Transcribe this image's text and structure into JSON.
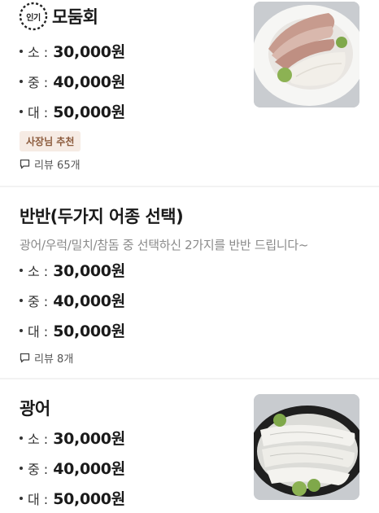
{
  "items": [
    {
      "badge": "인기",
      "name": "모둠회",
      "prices": [
        {
          "size": "소 :",
          "price": "30,000원"
        },
        {
          "size": "중 :",
          "price": "40,000원"
        },
        {
          "size": "대 :",
          "price": "50,000원"
        }
      ],
      "tag": "사장님 추천",
      "review": "리뷰 65개"
    },
    {
      "name": "반반(두가지 어종 선택)",
      "description": "광어/우럭/밀치/참돔 중 선택하신 2가지를 반반 드립니다~",
      "prices": [
        {
          "size": "소 :",
          "price": "30,000원"
        },
        {
          "size": "중 :",
          "price": "40,000원"
        },
        {
          "size": "대 :",
          "price": "50,000원"
        }
      ],
      "review": "리뷰 8개"
    },
    {
      "name": "광어",
      "prices": [
        {
          "size": "소 :",
          "price": "30,000원"
        },
        {
          "size": "중 :",
          "price": "40,000원"
        },
        {
          "size": "대 :",
          "price": "50,000원"
        }
      ]
    }
  ]
}
